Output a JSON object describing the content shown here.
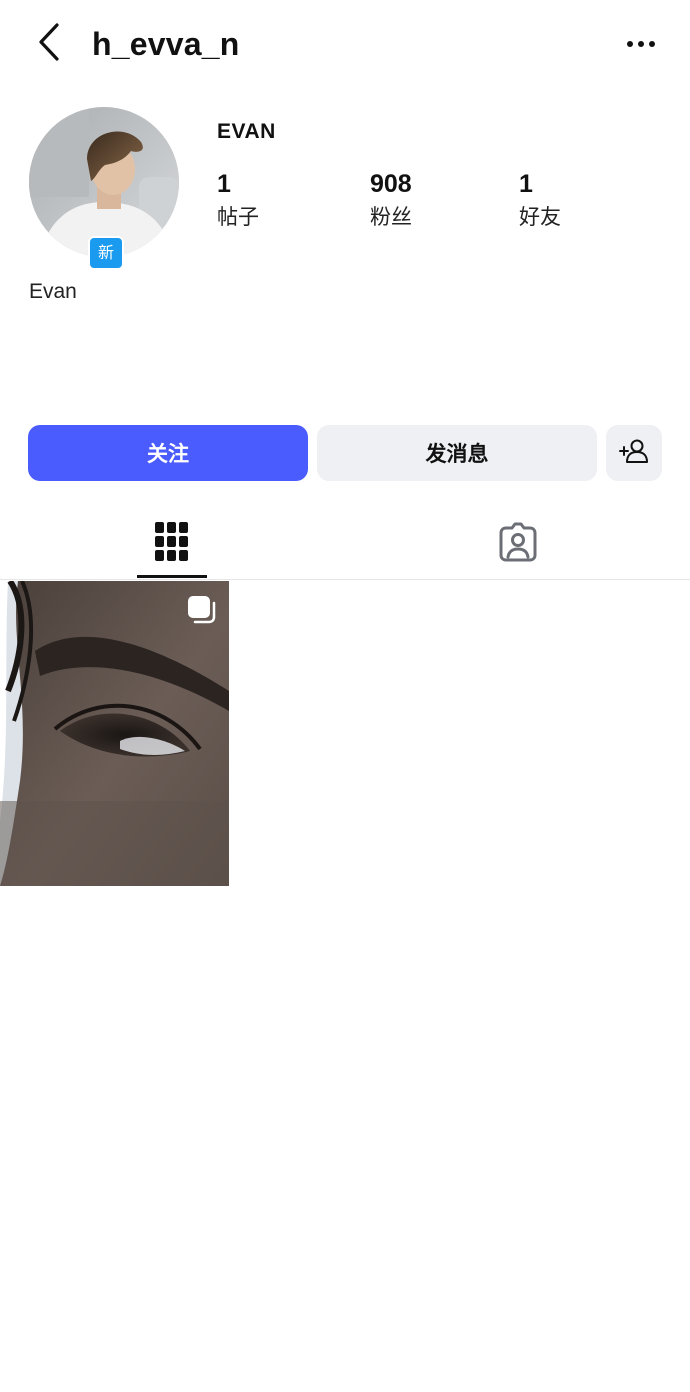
{
  "header": {
    "username": "h_evva_n",
    "back_icon": "chevron-left-icon",
    "more_icon": "more-horizontal-icon"
  },
  "profile": {
    "display_name": "EVAN",
    "badge_label": "新",
    "bio_name": "Evan",
    "stats": [
      {
        "value": "1",
        "label": "帖子"
      },
      {
        "value": "908",
        "label": "粉丝"
      },
      {
        "value": "1",
        "label": "好友"
      }
    ]
  },
  "actions": {
    "follow_label": "关注",
    "message_label": "发消息",
    "add_user_icon": "add-user-icon"
  },
  "tabs": [
    {
      "icon": "grid-icon",
      "active": true
    },
    {
      "icon": "tagged-user-icon",
      "active": false
    }
  ],
  "colors": {
    "accent": "#4b5cff",
    "secondary_button": "#eff0f3",
    "badge": "#1a9bf0"
  }
}
